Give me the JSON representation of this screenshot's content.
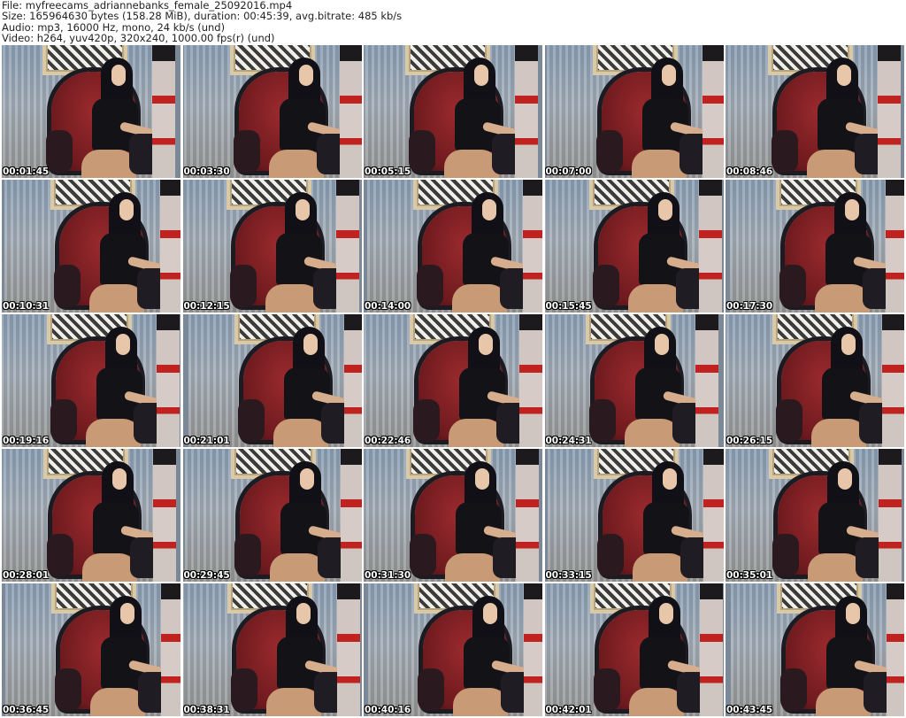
{
  "header": {
    "file_line": "File: myfreecams_adriannebanks_female_25092016.mp4",
    "size_line": "Size: 165964630 bytes (158.28 MiB), duration: 00:45:39, avg.bitrate: 485 kb/s",
    "audio_line": "Audio: mp3, 16000 Hz, mono, 24 kb/s (und)",
    "video_line": "Video: h264, yuv420p, 320x240, 1000.00 fps(r) (und)"
  },
  "thumbnails": [
    {
      "time": "00:01:45"
    },
    {
      "time": "00:03:30"
    },
    {
      "time": "00:05:15"
    },
    {
      "time": "00:07:00"
    },
    {
      "time": "00:08:46"
    },
    {
      "time": "00:10:31"
    },
    {
      "time": "00:12:15"
    },
    {
      "time": "00:14:00"
    },
    {
      "time": "00:15:45"
    },
    {
      "time": "00:17:30"
    },
    {
      "time": "00:19:16"
    },
    {
      "time": "00:21:01"
    },
    {
      "time": "00:22:46"
    },
    {
      "time": "00:24:31"
    },
    {
      "time": "00:26:15"
    },
    {
      "time": "00:28:01"
    },
    {
      "time": "00:29:45"
    },
    {
      "time": "00:31:30"
    },
    {
      "time": "00:33:15"
    },
    {
      "time": "00:35:01"
    },
    {
      "time": "00:36:45"
    },
    {
      "time": "00:38:31"
    },
    {
      "time": "00:40:16"
    },
    {
      "time": "00:42:01"
    },
    {
      "time": "00:43:45"
    }
  ]
}
